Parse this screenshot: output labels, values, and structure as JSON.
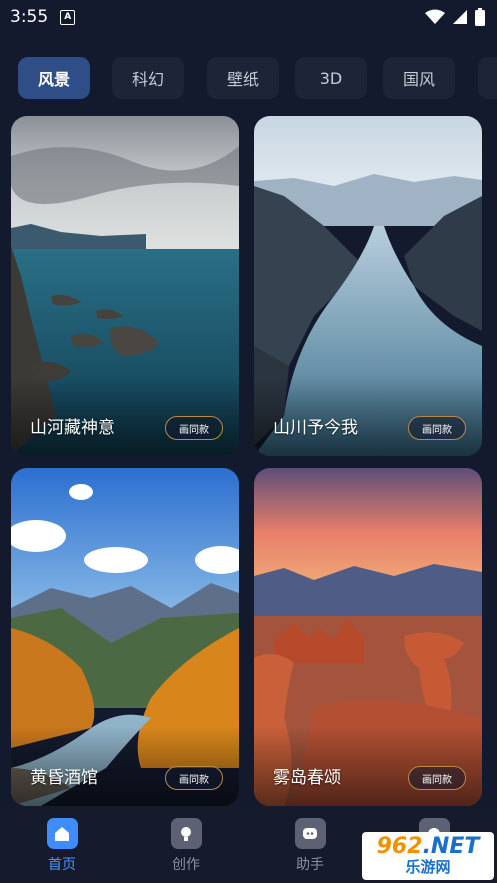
{
  "status_bar": {
    "time": "3:55",
    "notification_icon": "a-icon",
    "icons": [
      "wifi-icon",
      "signal-icon",
      "battery-icon"
    ]
  },
  "tabs": [
    {
      "label": "风景",
      "active": true
    },
    {
      "label": "科幻",
      "active": false
    },
    {
      "label": "壁纸",
      "active": false
    },
    {
      "label": "3D",
      "active": false
    },
    {
      "label": "国风",
      "active": false
    }
  ],
  "cards": [
    {
      "title": "山河藏神意",
      "button": "画同款"
    },
    {
      "title": "山川予今我",
      "button": "画同款"
    },
    {
      "title": "黄昏酒馆",
      "button": "画同款"
    },
    {
      "title": "雾岛春颂",
      "button": "画同款"
    }
  ],
  "bottom_nav": [
    {
      "label": "首页",
      "icon": "home-icon",
      "active": true
    },
    {
      "label": "创作",
      "icon": "bulb-icon",
      "active": false
    },
    {
      "label": "助手",
      "icon": "chat-icon",
      "active": false
    },
    {
      "label": "",
      "icon": "profile-icon",
      "active": false
    }
  ],
  "watermark": {
    "main_num": "962",
    "main_net": ".NET",
    "sub": "乐游网"
  },
  "colors": {
    "background": "#141a2e",
    "active_tab": "#2f4d86",
    "accent": "#3f8cff",
    "button_border": "#b88a45"
  }
}
